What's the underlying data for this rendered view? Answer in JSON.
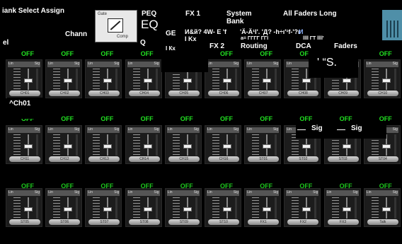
{
  "menu": {
    "bank_select": "iank Select Assign",
    "chann": "Chann",
    "el": "el",
    "peq": "PEQ",
    "eq": "EQ",
    "ge": "GE",
    "q": "Q",
    "fx1": "FX 1",
    "fx2": "FX 2",
    "system_bank": "System Bank",
    "all_faders": "All Faders Long",
    "routing": "Routing",
    "dca": "DCA",
    "faders": "Faders",
    "garbled1": "И&й? 4W- E 'f",
    "garbled2": "'Ä‑Ä¹I'. 'Д? ‑h÷ı'¹f‑'?r",
    "garbled3": "И",
    "garbled4": "I Kx",
    "garbled5": "I Кх",
    "garbled6": "' “S.",
    "garbled7": "llll ΓΤ llll'",
    "garbled8": "a=  ΓΓΓΓ ΓΓI"
  },
  "gate_widget": {
    "label_top": "Gate",
    "label_bottom": "Comp"
  },
  "strip_labels": {
    "off": "OFF",
    "lin": "Lin",
    "sig": "Sig"
  },
  "row1_buttons": [
    "CH01",
    "CH02",
    "CH03",
    "CH04",
    "CH05",
    "CH06",
    "CH07",
    "CH08",
    "CH09",
    "CH10"
  ],
  "row2_buttons": [
    "CH11",
    "CH12",
    "CH13",
    "CH14",
    "CH15",
    "CH16",
    "ST01",
    "ST02",
    "ST03",
    "ST04"
  ],
  "row3_buttons": [
    "ST05",
    "ST06",
    "ST07",
    "ST08",
    "ST09",
    "ST10",
    "FX1",
    "FX2",
    "FX3",
    "Talk"
  ],
  "ch01_label": "^Ch01",
  "sig_label": "Sig",
  "colors": {
    "off": "#21e021",
    "accent": "#4f8fa8"
  }
}
